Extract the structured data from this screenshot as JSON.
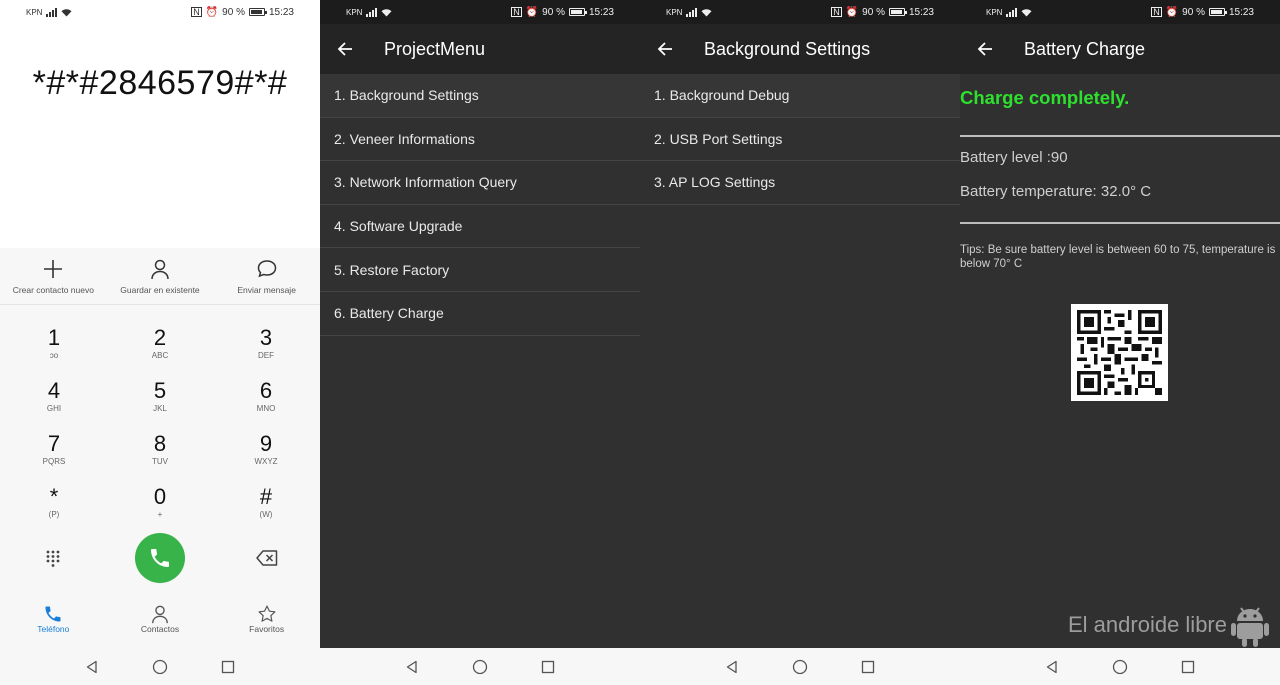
{
  "status": {
    "carrier": "KPN",
    "battery": "90 %",
    "time": "15:23"
  },
  "dialer": {
    "number": "*#*#2846579#*#",
    "actions": [
      {
        "label": "Crear contacto nuevo"
      },
      {
        "label": "Guardar en existente"
      },
      {
        "label": "Enviar mensaje"
      }
    ],
    "keys": [
      {
        "digit": "1",
        "letters": "ↄo"
      },
      {
        "digit": "2",
        "letters": "ABC"
      },
      {
        "digit": "3",
        "letters": "DEF"
      },
      {
        "digit": "4",
        "letters": "GHI"
      },
      {
        "digit": "5",
        "letters": "JKL"
      },
      {
        "digit": "6",
        "letters": "MNO"
      },
      {
        "digit": "7",
        "letters": "PQRS"
      },
      {
        "digit": "8",
        "letters": "TUV"
      },
      {
        "digit": "9",
        "letters": "WXYZ"
      },
      {
        "digit": "*",
        "letters": "(P)"
      },
      {
        "digit": "0",
        "letters": "+"
      },
      {
        "digit": "#",
        "letters": "(W)"
      }
    ],
    "tabs": [
      {
        "label": "Teléfono"
      },
      {
        "label": "Contactos"
      },
      {
        "label": "Favoritos"
      }
    ],
    "accent": "#1a7fd8",
    "call_color": "#37b34a"
  },
  "project_menu": {
    "title": "ProjectMenu",
    "items": [
      "1. Background Settings",
      "2. Veneer Informations",
      "3. Network Information Query",
      "4. Software Upgrade",
      "5. Restore Factory",
      "6. Battery Charge"
    ]
  },
  "background_settings": {
    "title": "Background Settings",
    "items": [
      "1. Background Debug",
      "2. USB Port Settings",
      "3. AP LOG Settings"
    ]
  },
  "battery_charge": {
    "title": "Battery Charge",
    "status": "Charge completely.",
    "level": "Battery level :90",
    "temperature": "Battery temperature: 32.0° C",
    "tips": "Tips: Be sure battery level is between 60 to 75, temperature is below 70° C",
    "status_color": "#2ee02e"
  },
  "watermark": "El androide libre"
}
